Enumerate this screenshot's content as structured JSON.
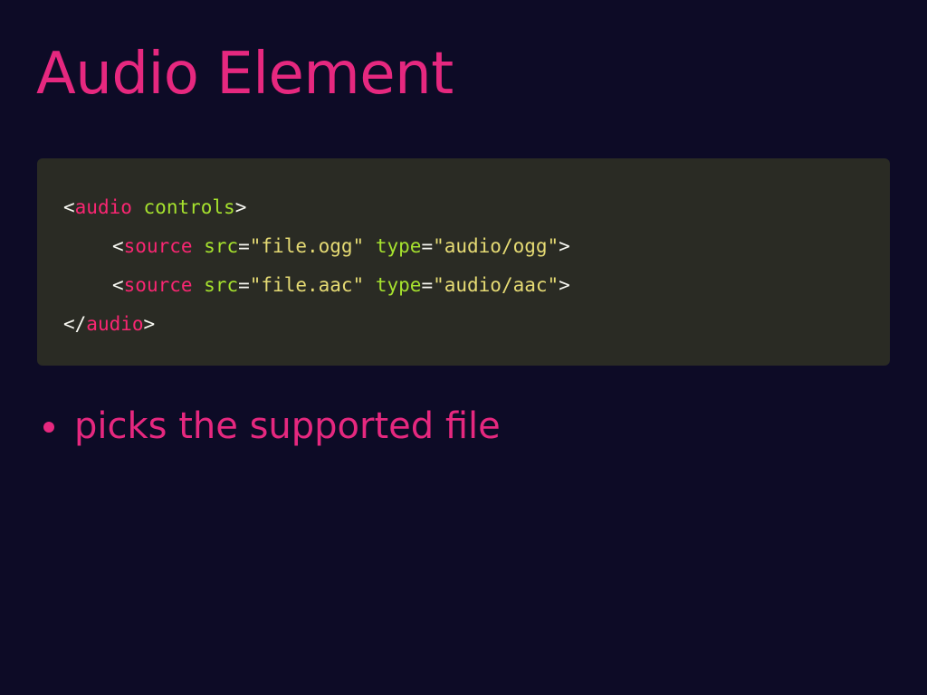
{
  "slide": {
    "title": "Audio Element",
    "colors": {
      "background": "#0d0b26",
      "accent": "#e6287f",
      "code_background": "#2a2b24",
      "code_punct": "#f8f8f2",
      "code_tag": "#f92672",
      "code_attr": "#a6e22e",
      "code_string": "#e6db74"
    }
  },
  "code": {
    "line1": {
      "open": "<",
      "tag": "audio",
      "sp": " ",
      "attr": "controls",
      "close": ">"
    },
    "line2": {
      "open": "<",
      "tag": "source",
      "sp1": " ",
      "attr1": "src",
      "eq1": "=",
      "val1": "\"file.ogg\"",
      "sp2": " ",
      "attr2": "type",
      "eq2": "=",
      "val2": "\"audio/ogg\"",
      "close": ">"
    },
    "line3": {
      "open": "<",
      "tag": "source",
      "sp1": " ",
      "attr1": "src",
      "eq1": "=",
      "val1": "\"file.aac\"",
      "sp2": " ",
      "attr2": "type",
      "eq2": "=",
      "val2": "\"audio/aac\"",
      "close": ">"
    },
    "line4": {
      "open": "</",
      "tag": "audio",
      "close": ">"
    }
  },
  "bullets": [
    {
      "text": "picks the supported file"
    }
  ]
}
